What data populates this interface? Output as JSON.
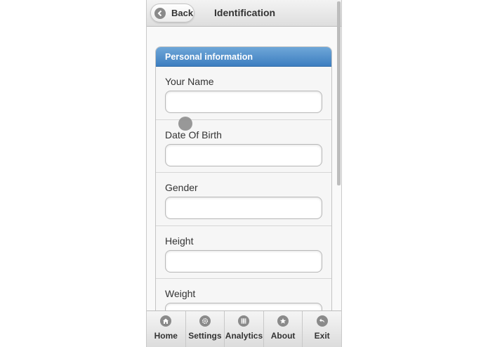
{
  "header": {
    "back_label": "Back",
    "title": "Identification"
  },
  "section": {
    "title": "Personal information"
  },
  "fields": [
    {
      "label": "Your Name",
      "value": ""
    },
    {
      "label": "Date Of Birth",
      "value": ""
    },
    {
      "label": "Gender",
      "value": ""
    },
    {
      "label": "Height",
      "value": ""
    },
    {
      "label": "Weight",
      "value": ""
    }
  ],
  "navbar": [
    {
      "label": "Home",
      "icon": "home-icon"
    },
    {
      "label": "Settings",
      "icon": "gear-icon"
    },
    {
      "label": "Analytics",
      "icon": "grid-icon"
    },
    {
      "label": "About",
      "icon": "star-icon"
    },
    {
      "label": "Exit",
      "icon": "back-arrow-icon"
    }
  ],
  "colors": {
    "section_header": "#4a8bc9",
    "background": "#f9f9f9"
  }
}
